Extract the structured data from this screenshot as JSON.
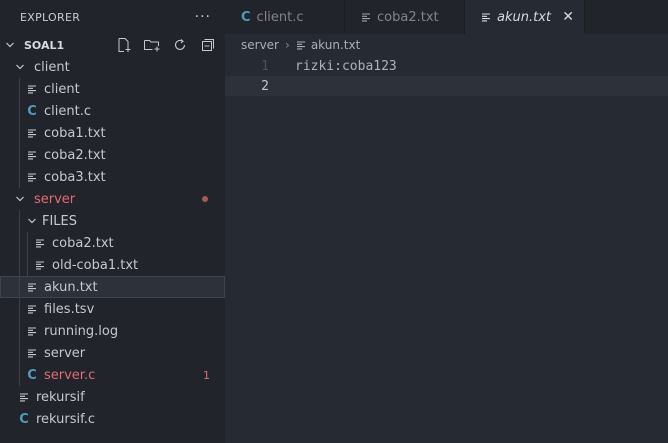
{
  "sidebar": {
    "title": "EXPLORER",
    "more_label": "···",
    "workspace": "SOAL1",
    "tree": {
      "client_folder": "client",
      "client_items": [
        "client",
        "client.c",
        "coba1.txt",
        "coba2.txt",
        "coba3.txt"
      ],
      "server_folder": "server",
      "files_folder": "FILES",
      "files_items": [
        "coba2.txt",
        "old-coba1.txt"
      ],
      "server_items": [
        "akun.txt",
        "files.tsv",
        "running.log",
        "server",
        "server.c"
      ],
      "server_c_errors": "1",
      "root_items": [
        "rekursif",
        "rekursif.c"
      ]
    }
  },
  "tabs": [
    {
      "label": "client.c",
      "icon": "c-file-icon"
    },
    {
      "label": "coba2.txt",
      "icon": "text-file-icon"
    },
    {
      "label": "akun.txt",
      "icon": "text-file-icon",
      "active": true
    }
  ],
  "tab_close_glyph": "✕",
  "breadcrumb": {
    "folder": "server",
    "separator": "›",
    "file": "akun.txt"
  },
  "editor": {
    "lines": [
      {
        "number": "1",
        "text": "rizki:coba123"
      },
      {
        "number": "2",
        "text": ""
      }
    ]
  },
  "colors": {
    "modified": "#e06c75",
    "c_icon": "#519aba",
    "sidebar_bg": "#21252b",
    "editor_bg": "#262a33"
  }
}
